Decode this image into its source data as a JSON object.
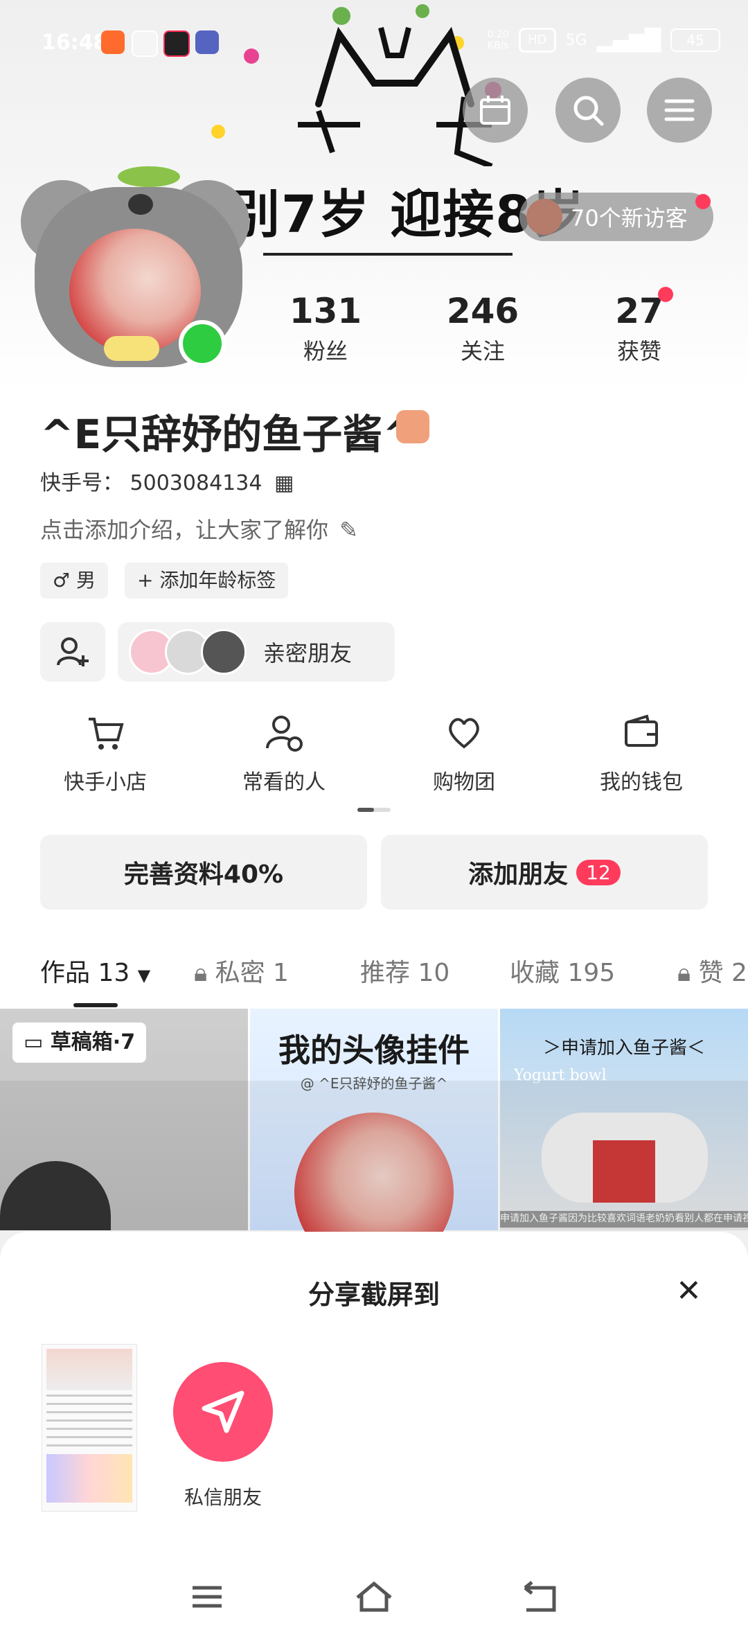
{
  "status_bar": {
    "time": "16:48",
    "speed": "0.20\nKB/s",
    "hd": "HD",
    "network": "5G",
    "battery": "45"
  },
  "header": {
    "banner": "别7岁 迎接8岁",
    "visitors": "70个新访客"
  },
  "stats": [
    {
      "num": "131",
      "label": "粉丝"
    },
    {
      "num": "246",
      "label": "关注"
    },
    {
      "num": "27",
      "label": "获赞"
    }
  ],
  "profile": {
    "name": "^E只辞妤的鱼子酱^",
    "id_label": "快手号：",
    "id": "5003084134",
    "intro": "点击添加介绍，让大家了解你",
    "gender_tag": "♂ 男",
    "age_tag": "+ 添加年龄标签",
    "close_friends": "亲密朋友"
  },
  "tools": [
    {
      "icon": "cart-icon",
      "label": "快手小店"
    },
    {
      "icon": "user-clock-icon",
      "label": "常看的人"
    },
    {
      "icon": "heart-group-icon",
      "label": "购物团"
    },
    {
      "icon": "wallet-icon",
      "label": "我的钱包"
    }
  ],
  "actions": {
    "complete": "完善资料40%",
    "add_friends": "添加朋友",
    "add_badge": "12"
  },
  "tabs": {
    "works": "作品 13",
    "private": "私密 1",
    "recommend": "推荐 10",
    "favorite": "收藏 195",
    "likes": "赞 2"
  },
  "grid": {
    "draft": "草稿箱·7",
    "item2_title": "我的头像挂件",
    "item2_sub": "@ ^E只辞妤的鱼子酱^",
    "item3_title": "＞申请加入鱼子酱＜",
    "item3_sub": "Yogurt bowl",
    "item3_caption": "申请加入鱼子酱因为比较喜欢词语老奶奶看别人都在申请视频"
  },
  "share_sheet": {
    "title": "分享截屏到",
    "dm_label": "私信朋友"
  },
  "colors": {
    "accent": "#ff3b5c",
    "online": "#2ecc40",
    "chip_bg": "#f2f2f2"
  }
}
